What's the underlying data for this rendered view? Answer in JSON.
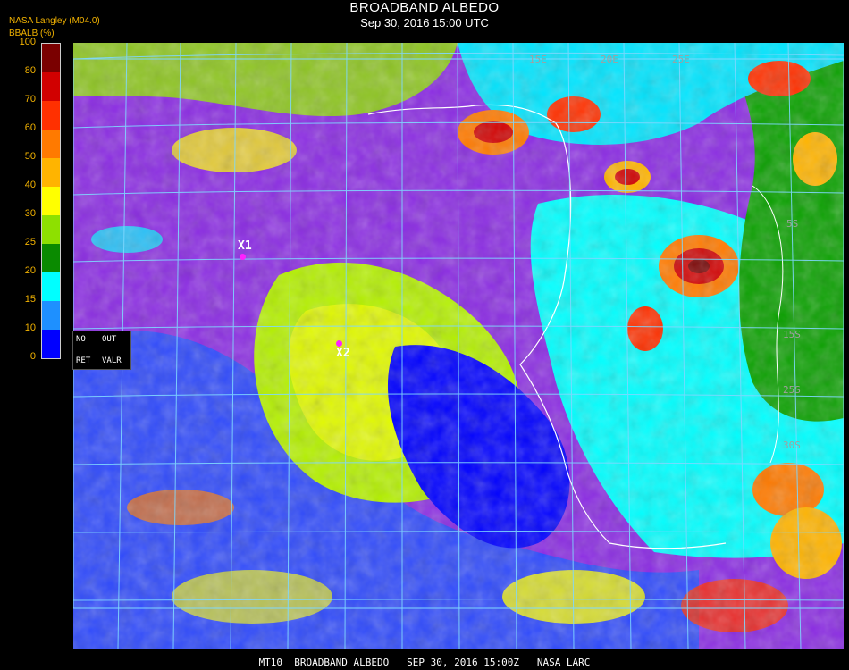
{
  "header": {
    "title": "BROADBAND ALBEDO",
    "datetime": "Sep 30, 2016 15:00 UTC",
    "source": "NASA Langley (M04.0)",
    "parameter": "BBALB (%)"
  },
  "legend": {
    "ticks": [
      "100",
      "80",
      "70",
      "60",
      "50",
      "40",
      "30",
      "25",
      "20",
      "15",
      "10",
      "0"
    ],
    "colors": [
      "#7a0000",
      "#d10000",
      "#ff3000",
      "#ff7a00",
      "#ffb400",
      "#ffff00",
      "#8ee000",
      "#0a8a00",
      "#00ffff",
      "#1e90ff",
      "#0000ff",
      "#8a2be2"
    ]
  },
  "controls": {
    "no": "NO",
    "out": "OUT",
    "ret": "RET",
    "valr": "VALR"
  },
  "markers": [
    {
      "label": "X1"
    },
    {
      "label": "X2"
    }
  ],
  "map_labels": {
    "lon_top": [
      "15E",
      "20E",
      "25E"
    ],
    "lat_right": [
      "5S",
      "15S",
      "25S",
      "30S"
    ]
  },
  "footer": "MT10  BROADBAND ALBEDO   SEP 30, 2016 15:00Z   NASA LARC"
}
